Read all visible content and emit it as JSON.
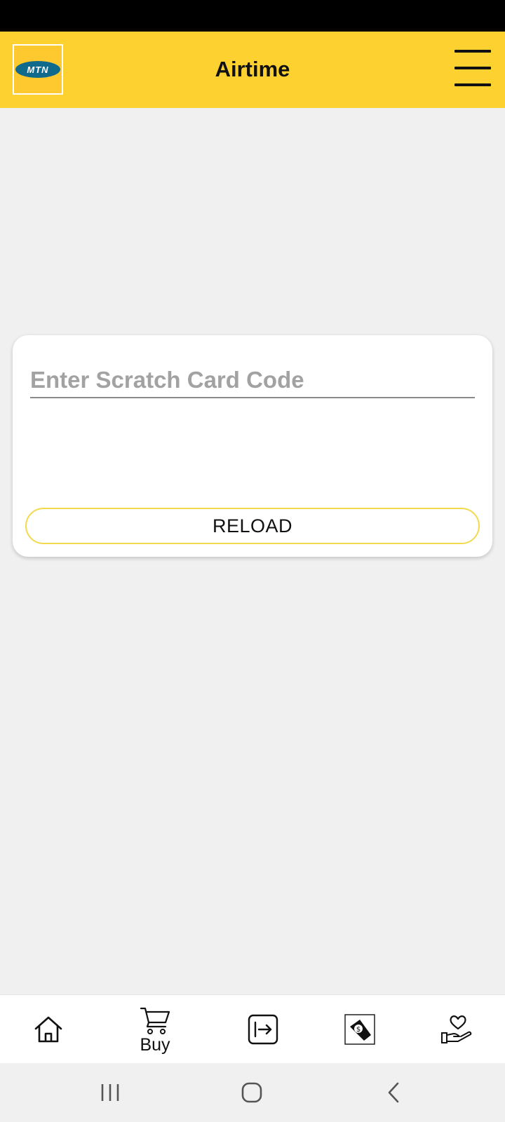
{
  "header": {
    "logo_text": "MTN",
    "title": "Airtime",
    "menu_icon": "hamburger-menu-icon"
  },
  "reload_card": {
    "input_value": "",
    "input_placeholder": "Enter Scratch Card Code",
    "button_label": "RELOAD"
  },
  "bottom_nav": {
    "items": [
      {
        "icon": "home-icon",
        "label": ""
      },
      {
        "icon": "shopping-cart-icon",
        "label": "Buy"
      },
      {
        "icon": "transfer-arrow-icon",
        "label": ""
      },
      {
        "icon": "money-icon",
        "label": ""
      },
      {
        "icon": "heart-hand-icon",
        "label": ""
      }
    ]
  },
  "system_nav": {
    "buttons": [
      "recent-apps-icon",
      "home-circle-icon",
      "back-chevron-icon"
    ]
  },
  "colors": {
    "brand_yellow": "#fdd130",
    "logo_blue": "#106a8c",
    "button_border": "#f2d94e",
    "background": "#f0f0f0"
  }
}
